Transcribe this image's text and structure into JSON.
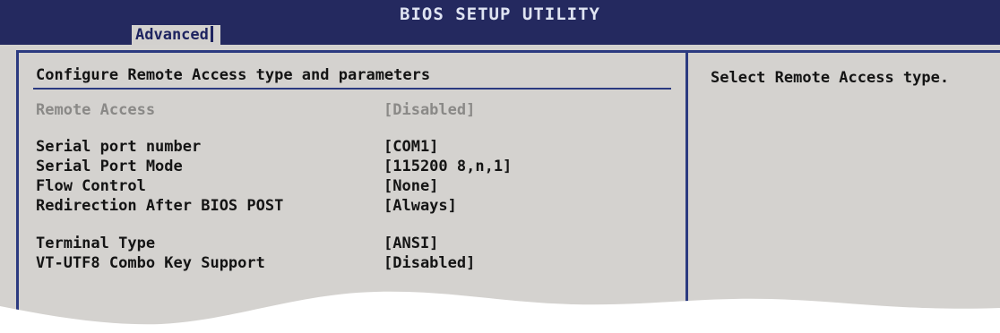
{
  "header": {
    "title": "BIOS SETUP UTILITY",
    "active_tab": "Advanced"
  },
  "main": {
    "section_title": "Configure Remote Access type and parameters",
    "settings": [
      {
        "label": "Remote Access",
        "value": "[Disabled]",
        "state": "greyed"
      },
      {
        "label": "Serial port number",
        "value": "[COM1]"
      },
      {
        "label": "Serial Port Mode",
        "value": "[115200 8,n,1]"
      },
      {
        "label": "Flow Control",
        "value": "[None]"
      },
      {
        "label": "Redirection After BIOS POST",
        "value": "[Always]"
      },
      {
        "label": "Terminal Type",
        "value": "[ANSI]"
      },
      {
        "label": "VT-UTF8 Combo Key Support",
        "value": "[Disabled]"
      }
    ]
  },
  "help_panel": {
    "text": "Select Remote Access type."
  },
  "colors": {
    "title_bar": "#24295f",
    "panel_bg": "#d4d2cf",
    "frame_line": "#2b3a80",
    "text": "#141414",
    "disabled_text": "#8a8987"
  }
}
